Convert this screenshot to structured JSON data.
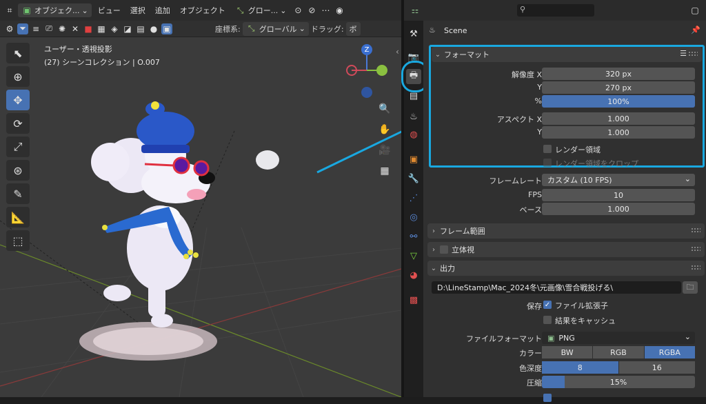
{
  "viewport": {
    "header": {
      "mode": "オブジェク...",
      "menus": [
        "ビュー",
        "選択",
        "追加",
        "オブジェクト"
      ],
      "orientation": "グロー..."
    },
    "toolbar": {
      "coords_label": "座標系:",
      "coords_value": "グローバル",
      "drag_label": "ドラッグ:",
      "drag_value": "ボ"
    },
    "info_line1": "ユーザー・透視投影",
    "info_line2": "(27) シーンコレクション | O.007",
    "gizmo_z": "Z"
  },
  "properties": {
    "scene_label": "Scene",
    "format": {
      "title": "フォーマット",
      "res_x_label": "解像度 X",
      "res_x": "320 px",
      "res_y_label": "Y",
      "res_y": "270 px",
      "percent_label": "%",
      "percent": "100%",
      "aspect_x_label": "アスペクト X",
      "aspect_x": "1.000",
      "aspect_y_label": "Y",
      "aspect_y": "1.000",
      "render_region": "レンダー領域",
      "crop_region": "レンダー領域をクロップ"
    },
    "frame_rate_label": "フレームレート",
    "frame_rate_value": "カスタム (10 FPS)",
    "fps_label": "FPS",
    "fps": "10",
    "base_label": "ベース",
    "base": "1.000",
    "sections": {
      "frame_range": "フレーム範囲",
      "stereo": "立体視",
      "output": "出力"
    },
    "output": {
      "path": "D:\\LineStamp\\Mac_2024冬\\元画像\\雪合戦投げる\\",
      "save_label": "保存",
      "file_ext": "ファイル拡張子",
      "cache_result": "結果をキャッシュ",
      "file_format_label": "ファイルフォーマット",
      "file_format": "PNG",
      "color_label": "カラー",
      "color_options": [
        "BW",
        "RGB",
        "RGBA"
      ],
      "depth_label": "色深度",
      "depth_options": [
        "8",
        "16"
      ],
      "compression_label": "圧縮",
      "compression": "15%",
      "compression_fraction": 0.15
    }
  },
  "colors": {
    "accent": "#4772b3",
    "highlight": "#19a8e0"
  }
}
